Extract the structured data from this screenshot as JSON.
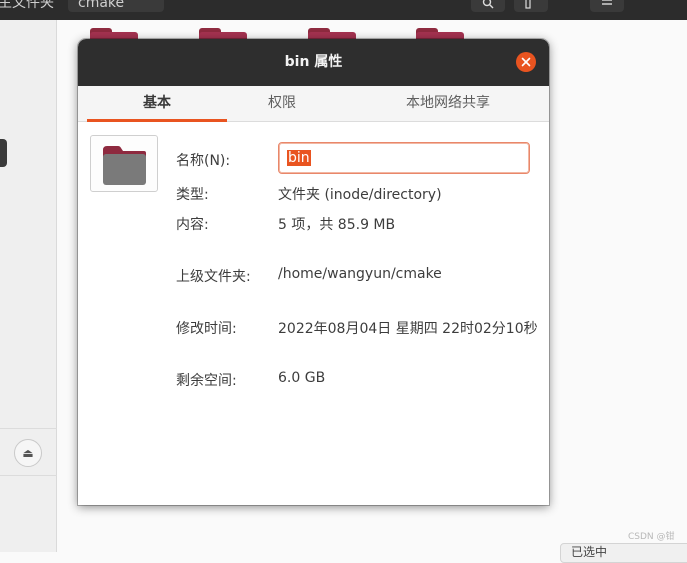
{
  "background": {
    "path": [
      "主文件夹",
      "cmake"
    ],
    "header_buttons": [
      "search-icon",
      "view-icon",
      "menu-icon"
    ],
    "statusbar_text": "已选中"
  },
  "watermark": "CSDN @钳",
  "dialog": {
    "title": "bin 属性",
    "tabs": [
      "基本",
      "权限",
      "本地网络共享"
    ],
    "active_tab": 0,
    "name_label": "名称(N):",
    "name_value": "bin",
    "rows": [
      {
        "label": "类型:",
        "value": "文件夹 (inode/directory)"
      },
      {
        "label": "内容:",
        "value": "5 项，共 85.9 MB"
      },
      {
        "label": "上级文件夹:",
        "value": "/home/wangyun/cmake"
      },
      {
        "label": "修改时间:",
        "value": "2022年08月04日 星期四 22时02分10秒"
      },
      {
        "label": "剩余空间:",
        "value": "6.0 GB"
      }
    ]
  },
  "colors": {
    "accent": "#e95420",
    "titlebar": "#2e2e2e",
    "folder_tab": "#8e2a3f",
    "folder_body": "#7a7a7a"
  }
}
